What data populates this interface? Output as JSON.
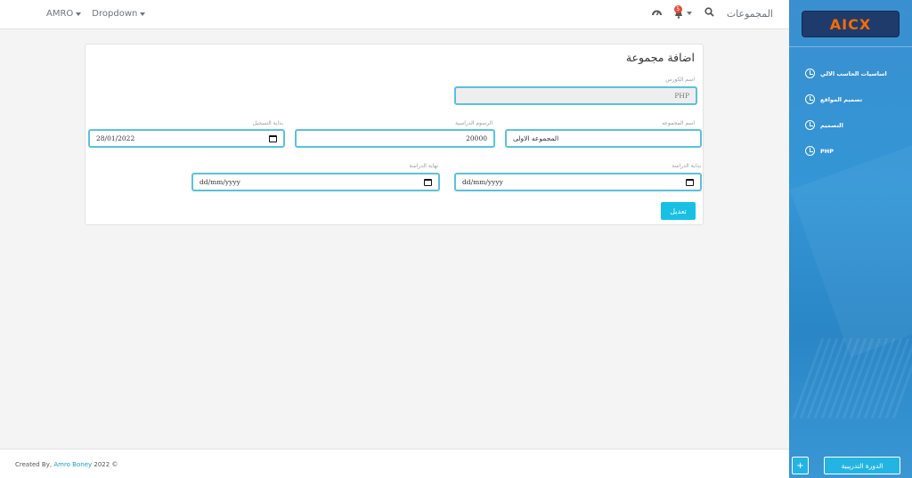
{
  "navbar": {
    "user": "AMRO",
    "dropdown": "Dropdown",
    "title": "المجموعات",
    "notification_count": "5"
  },
  "form": {
    "title": "اضافة مجموعة",
    "course_name_label": "اسم الكورس",
    "course_name_value": "PHP",
    "group_name_label": "اسم المجموعه",
    "group_name_value": "المجموعه الاولى",
    "fees_label": "الرسوم الدراسية",
    "fees_value": "20000",
    "registration_start_label": "بداية التسجيل",
    "registration_start_value": "28/01/2022",
    "study_start_label": "بداية الدراسة",
    "study_start_value": "dd/mm/yyyy",
    "study_end_label": "نهاية الدراسة",
    "study_end_value": "dd/mm/yyyy",
    "submit_label": "تعديل"
  },
  "footer": {
    "prefix": "Created By,",
    "author": "Amro Boney",
    "suffix": "2022 ©"
  },
  "sidebar": {
    "logo_text": "AICX",
    "items": [
      {
        "label": "اساسيات الحاسب الالي"
      },
      {
        "label": "تصميم المواقع"
      },
      {
        "label": "التصميم"
      },
      {
        "label": "PHP"
      }
    ],
    "course_button": "الدورة التدريبية",
    "add_button": "+"
  },
  "colors": {
    "accent": "#17c0e4",
    "input_border": "#5bc0de",
    "sidebar": "#3396d6"
  }
}
